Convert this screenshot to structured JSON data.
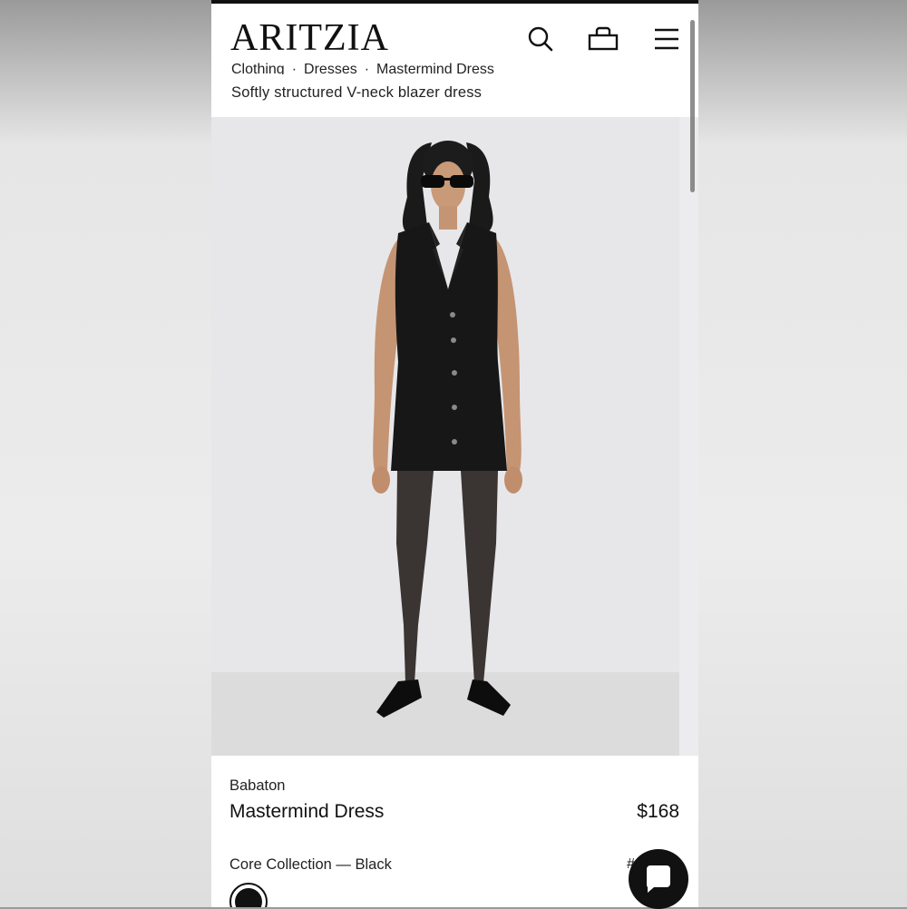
{
  "header": {
    "logo": "ARITZIA",
    "breadcrumb": [
      "Clothing",
      "Dresses",
      "Mastermind Dress"
    ],
    "subtitle": "Softly structured V-neck blazer dress"
  },
  "icons": {
    "search": "search-icon",
    "bag": "shopping-bag-icon",
    "menu": "hamburger-menu-icon",
    "chat": "chat-bubble-icon"
  },
  "product": {
    "brand": "Babaton",
    "name": "Mastermind Dress",
    "price": "$168",
    "color_label": "Core Collection — Black",
    "partial_code": "#",
    "swatch_color": "#111111"
  },
  "colors": {
    "accent": "#111111",
    "background": "#ffffff",
    "hero_bg": "#e7e7e9"
  }
}
